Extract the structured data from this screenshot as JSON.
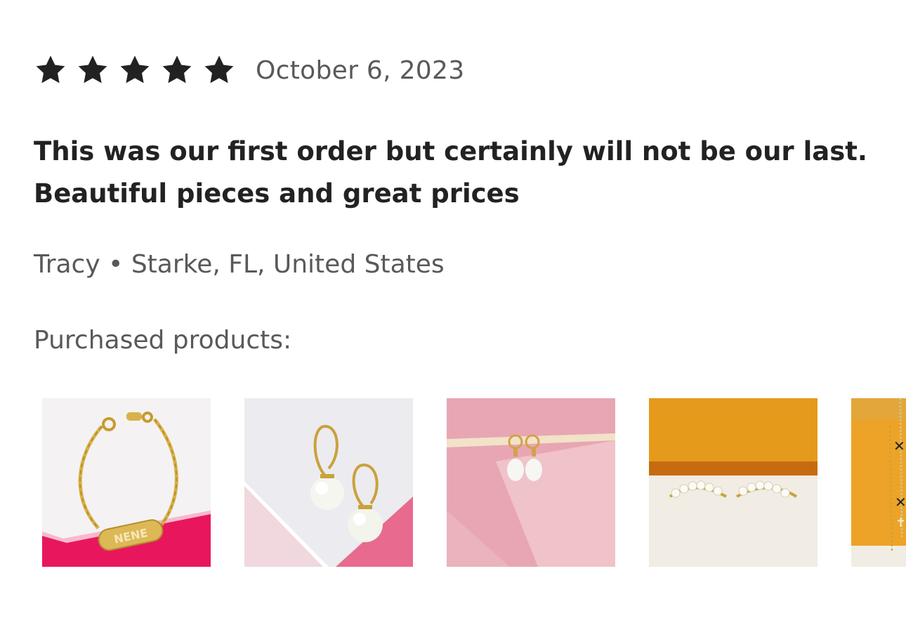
{
  "review": {
    "rating": 5,
    "max_rating": 5,
    "star_icon": "star-icon",
    "star_color": "#222222",
    "date": "October 6, 2023",
    "text": "This was our first order but certainly will not be our last. Beautiful pieces and great prices",
    "reviewer_name": "Tracy",
    "separator": "•",
    "reviewer_location": "Starke, FL, United States",
    "purchased_label": "Purchased products:"
  },
  "products": [
    {
      "id": "bracelet",
      "engraving": "NENE",
      "alt": "gold name bracelet"
    },
    {
      "id": "pearl-lever-earrings",
      "alt": "pearl leverback earrings"
    },
    {
      "id": "pearl-huggie-earrings",
      "alt": "pearl drop huggie earrings"
    },
    {
      "id": "pearl-climber-earrings",
      "alt": "pearl climber earrings"
    },
    {
      "id": "cross-chain",
      "alt": "cross chain necklace"
    }
  ],
  "colors": {
    "text_primary": "#222222",
    "text_secondary": "#595959",
    "background": "#ffffff"
  }
}
